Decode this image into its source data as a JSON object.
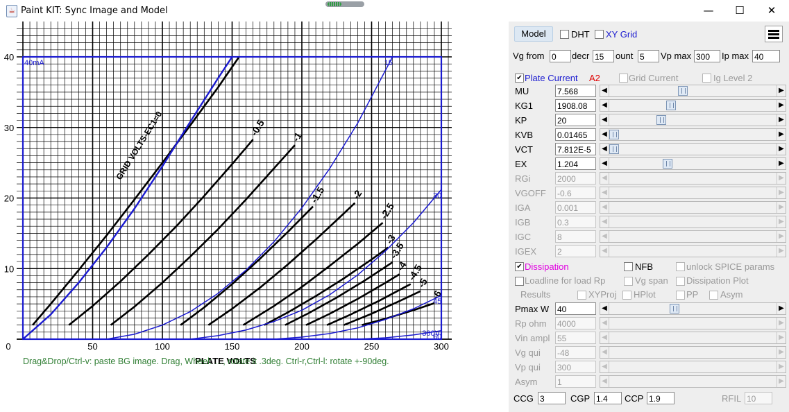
{
  "window": {
    "title": "Paint KIT: Sync Image and Model",
    "app_icon": "java-cup-icon",
    "minimize_label": "—",
    "maximize_label": "☐",
    "close_label": "✕"
  },
  "chart": {
    "status_text": "Drag&Drop/Ctrl-v: paste BG image. Drag, Wheel: …, rotate it .3deg. Ctrl-r,Ctrl-l: rotate +-90deg.",
    "overlay_label_ma": "40mA",
    "overlay_label_v": "300V"
  },
  "chart_data": {
    "type": "line",
    "title": "",
    "xlabel": "PLATE VOLTS",
    "ylabel": "",
    "xlim": [
      0,
      300
    ],
    "ylim": [
      0,
      40
    ],
    "x_ticks": [
      "0",
      "50",
      "100",
      "150",
      "200",
      "250",
      "300"
    ],
    "y_ticks": [
      "0",
      "10",
      "20",
      "30",
      "40"
    ],
    "grid": true,
    "curve_legend": "GRID VOLTS-EC1=0",
    "series": [
      {
        "name": "0",
        "x": [
          7,
          20,
          40,
          60,
          80,
          100,
          120,
          140,
          155
        ],
        "y": [
          2,
          5,
          9.8,
          14.7,
          19.8,
          25,
          30.3,
          35.7,
          40
        ]
      },
      {
        "name": "-0.5",
        "x": [
          33,
          50,
          70,
          90,
          110,
          130,
          150,
          165
        ],
        "y": [
          2,
          4.7,
          8.2,
          12,
          16,
          20.3,
          24.8,
          28.3
        ]
      },
      {
        "name": "-1",
        "x": [
          63,
          80,
          100,
          120,
          140,
          160,
          180,
          195
        ],
        "y": [
          2,
          4.6,
          8,
          11.7,
          15.6,
          19.8,
          24.2,
          27.5
        ]
      },
      {
        "name": "-1.5",
        "x": [
          113,
          130,
          150,
          170,
          190,
          208
        ],
        "y": [
          2,
          4.5,
          7.8,
          11.4,
          15.2,
          18.8
        ]
      },
      {
        "name": "-2",
        "x": [
          133,
          150,
          170,
          190,
          210,
          230,
          238
        ],
        "y": [
          2,
          4.3,
          7.3,
          10.6,
          14.1,
          17.8,
          19.3
        ]
      },
      {
        "name": "-2.5",
        "x": [
          158,
          180,
          200,
          220,
          240,
          258
        ],
        "y": [
          2,
          4.7,
          7.4,
          10.4,
          13.5,
          16.5
        ]
      },
      {
        "name": "-3",
        "x": [
          173,
          190,
          210,
          230,
          250,
          262
        ],
        "y": [
          2,
          3.8,
          6.1,
          8.6,
          11.3,
          13
        ]
      },
      {
        "name": "-3.5",
        "x": [
          188,
          205,
          225,
          245,
          265
        ],
        "y": [
          2,
          3.7,
          5.9,
          8.3,
          10.9
        ]
      },
      {
        "name": "-4",
        "x": [
          203,
          220,
          240,
          260,
          270
        ],
        "y": [
          2,
          3.6,
          5.7,
          8,
          9.2
        ]
      },
      {
        "name": "-4.5",
        "x": [
          218,
          235,
          255,
          275,
          278
        ],
        "y": [
          2,
          3.5,
          5.4,
          7.5,
          7.8
        ]
      },
      {
        "name": "-5",
        "x": [
          230,
          250,
          270,
          285
        ],
        "y": [
          2,
          3.6,
          5.4,
          6.8
        ]
      },
      {
        "name": "-6",
        "x": [
          243,
          260,
          280,
          295
        ],
        "y": [
          2,
          2.9,
          4.1,
          5.1
        ]
      }
    ],
    "model_series": [
      {
        "name": "0",
        "label": "",
        "x": [
          0,
          20,
          40,
          60,
          80,
          100,
          120,
          140,
          150
        ],
        "y": [
          0,
          3.5,
          8,
          13,
          18.5,
          24.5,
          30.8,
          37,
          40
        ]
      },
      {
        "name": "-15",
        "label": "15",
        "x": [
          60,
          80,
          100,
          120,
          140,
          160,
          180,
          200,
          220,
          240,
          265
        ],
        "y": [
          0,
          0.7,
          2,
          3.9,
          6.5,
          9.8,
          13.8,
          18.6,
          24.2,
          30.6,
          40
        ]
      },
      {
        "name": "-30",
        "label": "30",
        "x": [
          120,
          140,
          160,
          180,
          200,
          220,
          240,
          260,
          280,
          300
        ],
        "y": [
          0,
          0.5,
          1.3,
          2.5,
          4.1,
          6.3,
          9.1,
          12.5,
          16.5,
          21.2
        ]
      },
      {
        "name": "-45",
        "label": "45",
        "x": [
          180,
          200,
          220,
          240,
          260,
          280,
          300
        ],
        "y": [
          0,
          0.3,
          0.8,
          1.6,
          2.8,
          4.3,
          6.2
        ]
      },
      {
        "name": "-60",
        "label": "60",
        "x": [
          240,
          260,
          280,
          300
        ],
        "y": [
          0,
          0.2,
          0.6,
          1.2
        ]
      }
    ]
  },
  "panel": {
    "model_button": "Model",
    "dht_label": "DHT",
    "xy_grid_label": "XY Grid",
    "menu_icon": "hamburger-menu-icon",
    "vg_from_label": "Vg from",
    "vg_from_value": "0",
    "decr_label": "decr",
    "decr_value": "15",
    "count_label": "ount",
    "count_value": "5",
    "vp_max_label": "Vp max",
    "vp_max_value": "300",
    "ip_max_label": "Ip max",
    "ip_max_value": "40",
    "plate_current_label": "Plate Current",
    "plate_current_checked": true,
    "a2_label": "A2",
    "grid_current_label": "Grid Current",
    "ig_level2_label": "Ig Level 2",
    "params": [
      {
        "label": "MU",
        "value": "7.568",
        "slider": 0.44,
        "enabled": true
      },
      {
        "label": "KG1",
        "value": "1908.08",
        "slider": 0.37,
        "enabled": true
      },
      {
        "label": "KP",
        "value": "20",
        "slider": 0.31,
        "enabled": true
      },
      {
        "label": "KVB",
        "value": "0.01465",
        "slider": 0.03,
        "enabled": true
      },
      {
        "label": "VCT",
        "value": "7.812E-5",
        "slider": 0.03,
        "enabled": true
      },
      {
        "label": "EX",
        "value": "1.204",
        "slider": 0.35,
        "enabled": true
      },
      {
        "label": "RGi",
        "value": "2000",
        "slider": 0,
        "enabled": false
      },
      {
        "label": "VGOFF",
        "value": "-0.6",
        "slider": 0,
        "enabled": false
      },
      {
        "label": "IGA",
        "value": "0.001",
        "slider": 0,
        "enabled": false
      },
      {
        "label": "IGB",
        "value": "0.3",
        "slider": 0,
        "enabled": false
      },
      {
        "label": "IGC",
        "value": "8",
        "slider": 0,
        "enabled": false
      },
      {
        "label": "IGEX",
        "value": "2",
        "slider": 0,
        "enabled": false
      }
    ],
    "dissipation_label": "Dissipation",
    "dissipation_checked": true,
    "nfb_label": "NFB",
    "unlock_spice_label": "unlock SPICE params",
    "loadline_label": "Loadline for load Rp",
    "vg_span_label": "Vg span",
    "dissipation_plot_label": "Dissipation Plot",
    "results_label": "Results",
    "xyproj_label": "XYProj",
    "hplot_label": "HPlot",
    "pp_label": "PP",
    "asym_check_label": "Asym",
    "loadline_params": [
      {
        "label": "Pmax W",
        "value": "40",
        "slider": 0.39,
        "enabled": true
      },
      {
        "label": "Rp ohm",
        "value": "4000",
        "slider": 0,
        "enabled": false
      },
      {
        "label": "Vin ampl",
        "value": "55",
        "slider": 0,
        "enabled": false
      },
      {
        "label": "Vg qui",
        "value": "-48",
        "slider": 0,
        "enabled": false
      },
      {
        "label": "Vp qui",
        "value": "300",
        "slider": 0,
        "enabled": false
      },
      {
        "label": "Asym",
        "value": "1",
        "slider": 0,
        "enabled": false
      }
    ],
    "ccg_label": "CCG",
    "ccg_value": "3",
    "cgp_label": "CGP",
    "cgp_value": "1.4",
    "ccp_label": "CCP",
    "ccp_value": "1.9",
    "rfil_label": "RFIL",
    "rfil_value": "10"
  }
}
